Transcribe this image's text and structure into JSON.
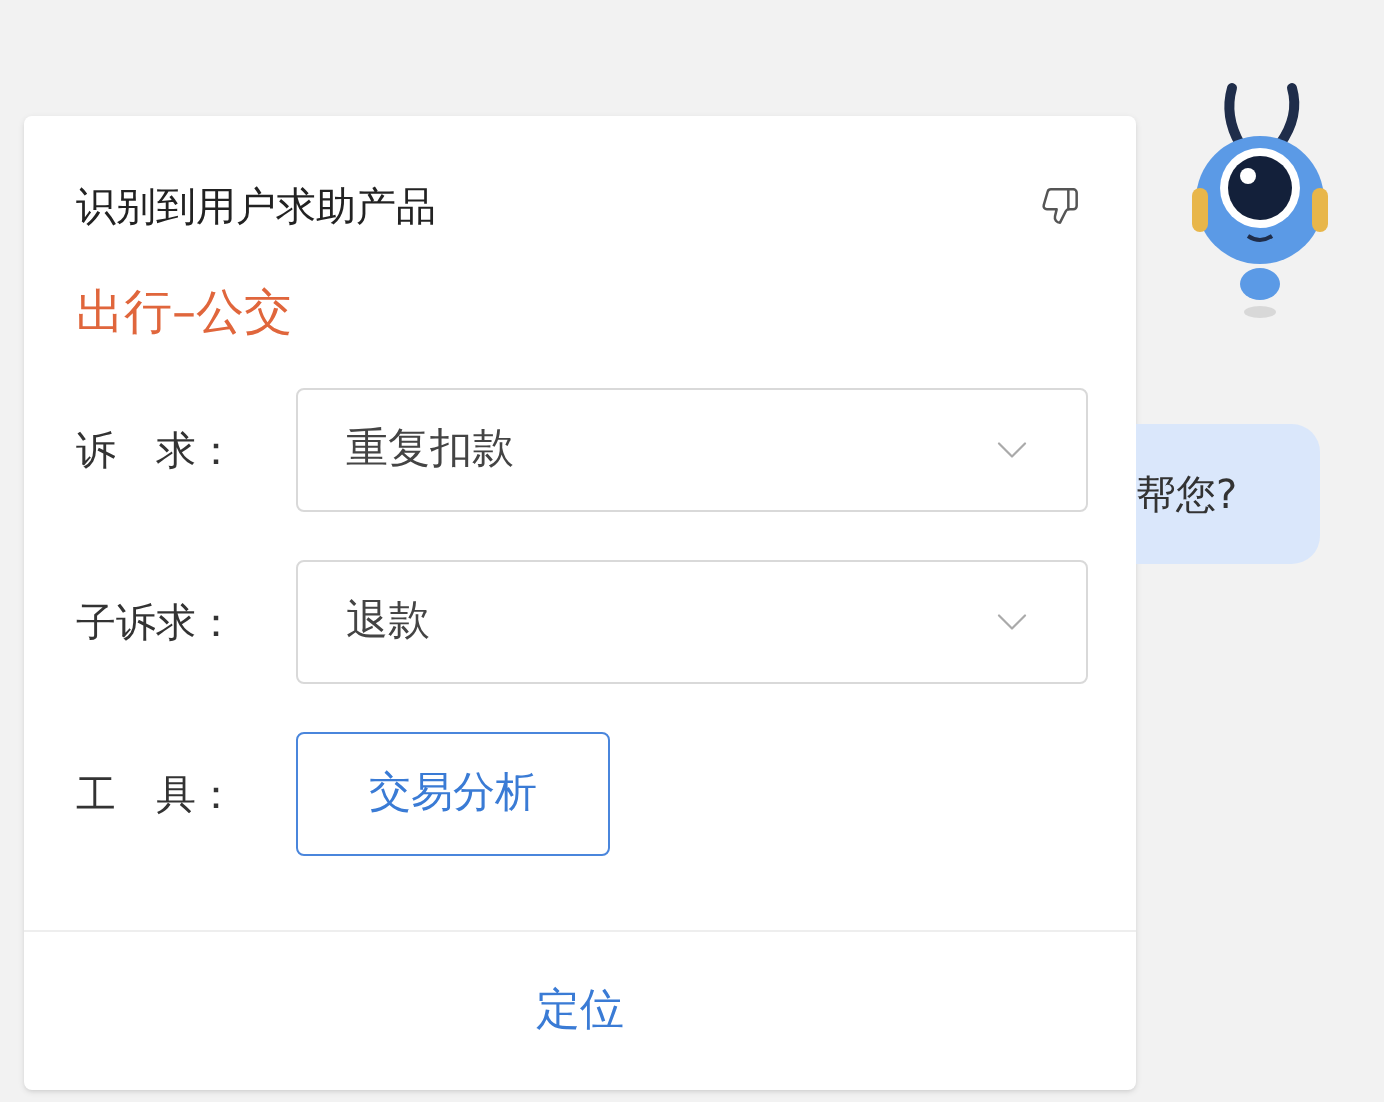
{
  "popover": {
    "title": "识别到用户求助产品",
    "product": "出行–公交",
    "fields": [
      {
        "label": "诉　求：",
        "value": "重复扣款"
      },
      {
        "label": "子诉求：",
        "value": "退款"
      }
    ],
    "tool": {
      "label": "工　具：",
      "button": "交易分析"
    },
    "footer_action": "定位"
  },
  "chat": {
    "message": "帮您?"
  }
}
